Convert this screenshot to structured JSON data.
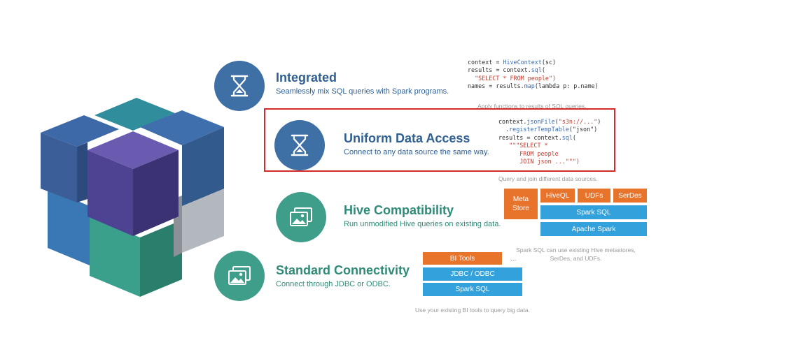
{
  "features": {
    "integrated": {
      "title": "Integrated",
      "desc": "Seamlessly mix SQL queries with Spark programs.",
      "icon": "hourglass-icon"
    },
    "uniform": {
      "title": "Uniform Data Access",
      "desc": "Connect to any data source the same way.",
      "icon": "hourglass-icon"
    },
    "hive": {
      "title": "Hive Compatibility",
      "desc": "Run unmodified  Hive queries on existing data.",
      "icon": "images-icon"
    },
    "connectivity": {
      "title": "Standard Connectivity",
      "desc": "Connect through  JDBC or ODBC.",
      "icon": "images-icon"
    }
  },
  "code1": {
    "l1a": "context = ",
    "l1b": "HiveContext",
    "l1c": "(sc)",
    "l2a": "results = context.",
    "l2b": "sql",
    "l2c": "(",
    "l3": "  \"SELECT * FROM people\")",
    "l4a": "names = results.",
    "l4b": "map",
    "l4c": "(lambda p: p.name)",
    "caption": "Apply functions to results of SQL queries."
  },
  "code2": {
    "l1a": "context.",
    "l1b": "jsonFile",
    "l1c": "(",
    "l1d": "\"s3n://...\"",
    "l1e": ")",
    "l2a": "  .",
    "l2b": "registerTempTable",
    "l2c": "(\"json\")",
    "l3a": "results = context.",
    "l3b": "sql",
    "l3c": "(",
    "l4": "   \"\"\"SELECT *",
    "l5": "      FROM people",
    "l6": "      JOIN json ...\"\"\")",
    "caption": "Query and join different data sources."
  },
  "hive_stack": {
    "metastore": "Meta Store",
    "hiveql": "HiveQL",
    "udfs": "UDFs",
    "serdes": "SerDes",
    "sparksql": "Spark SQL",
    "apachespark": "Apache Spark",
    "caption": "Spark SQL can use existing Hive metastores, SerDes, and UDFs."
  },
  "conn_stack": {
    "bitools": "BI Tools",
    "ellipsis": "...",
    "jdbc": "JDBC / ODBC",
    "sparksql": "Spark SQL",
    "caption": "Use your existing BI tools to query big data."
  },
  "colors": {
    "blue": "#3e6fa5",
    "teal": "#3e9e8a",
    "orange": "#e8742c",
    "light_blue": "#33a1dc",
    "highlight": "#d42a2a"
  }
}
